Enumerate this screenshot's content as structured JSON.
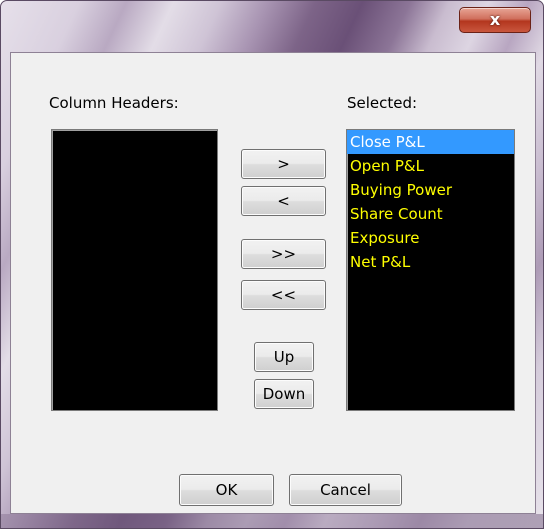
{
  "window": {
    "close_label": "x"
  },
  "labels": {
    "available": "Column Headers:",
    "selected": "Selected:"
  },
  "available_columns": [],
  "selected_columns": [
    "Close P&L",
    "Open P&L",
    "Buying Power",
    "Share Count",
    "Exposure",
    "Net P&L"
  ],
  "selected_index": 0,
  "buttons": {
    "add": ">",
    "remove": "<",
    "add_all": ">>",
    "remove_all": "<<",
    "up": "Up",
    "down": "Down",
    "ok": "OK",
    "cancel": "Cancel"
  },
  "colors": {
    "list_background": "#000000",
    "list_text": "#ffff00",
    "selection_background": "#3399ff",
    "selection_text": "#ffffff"
  }
}
